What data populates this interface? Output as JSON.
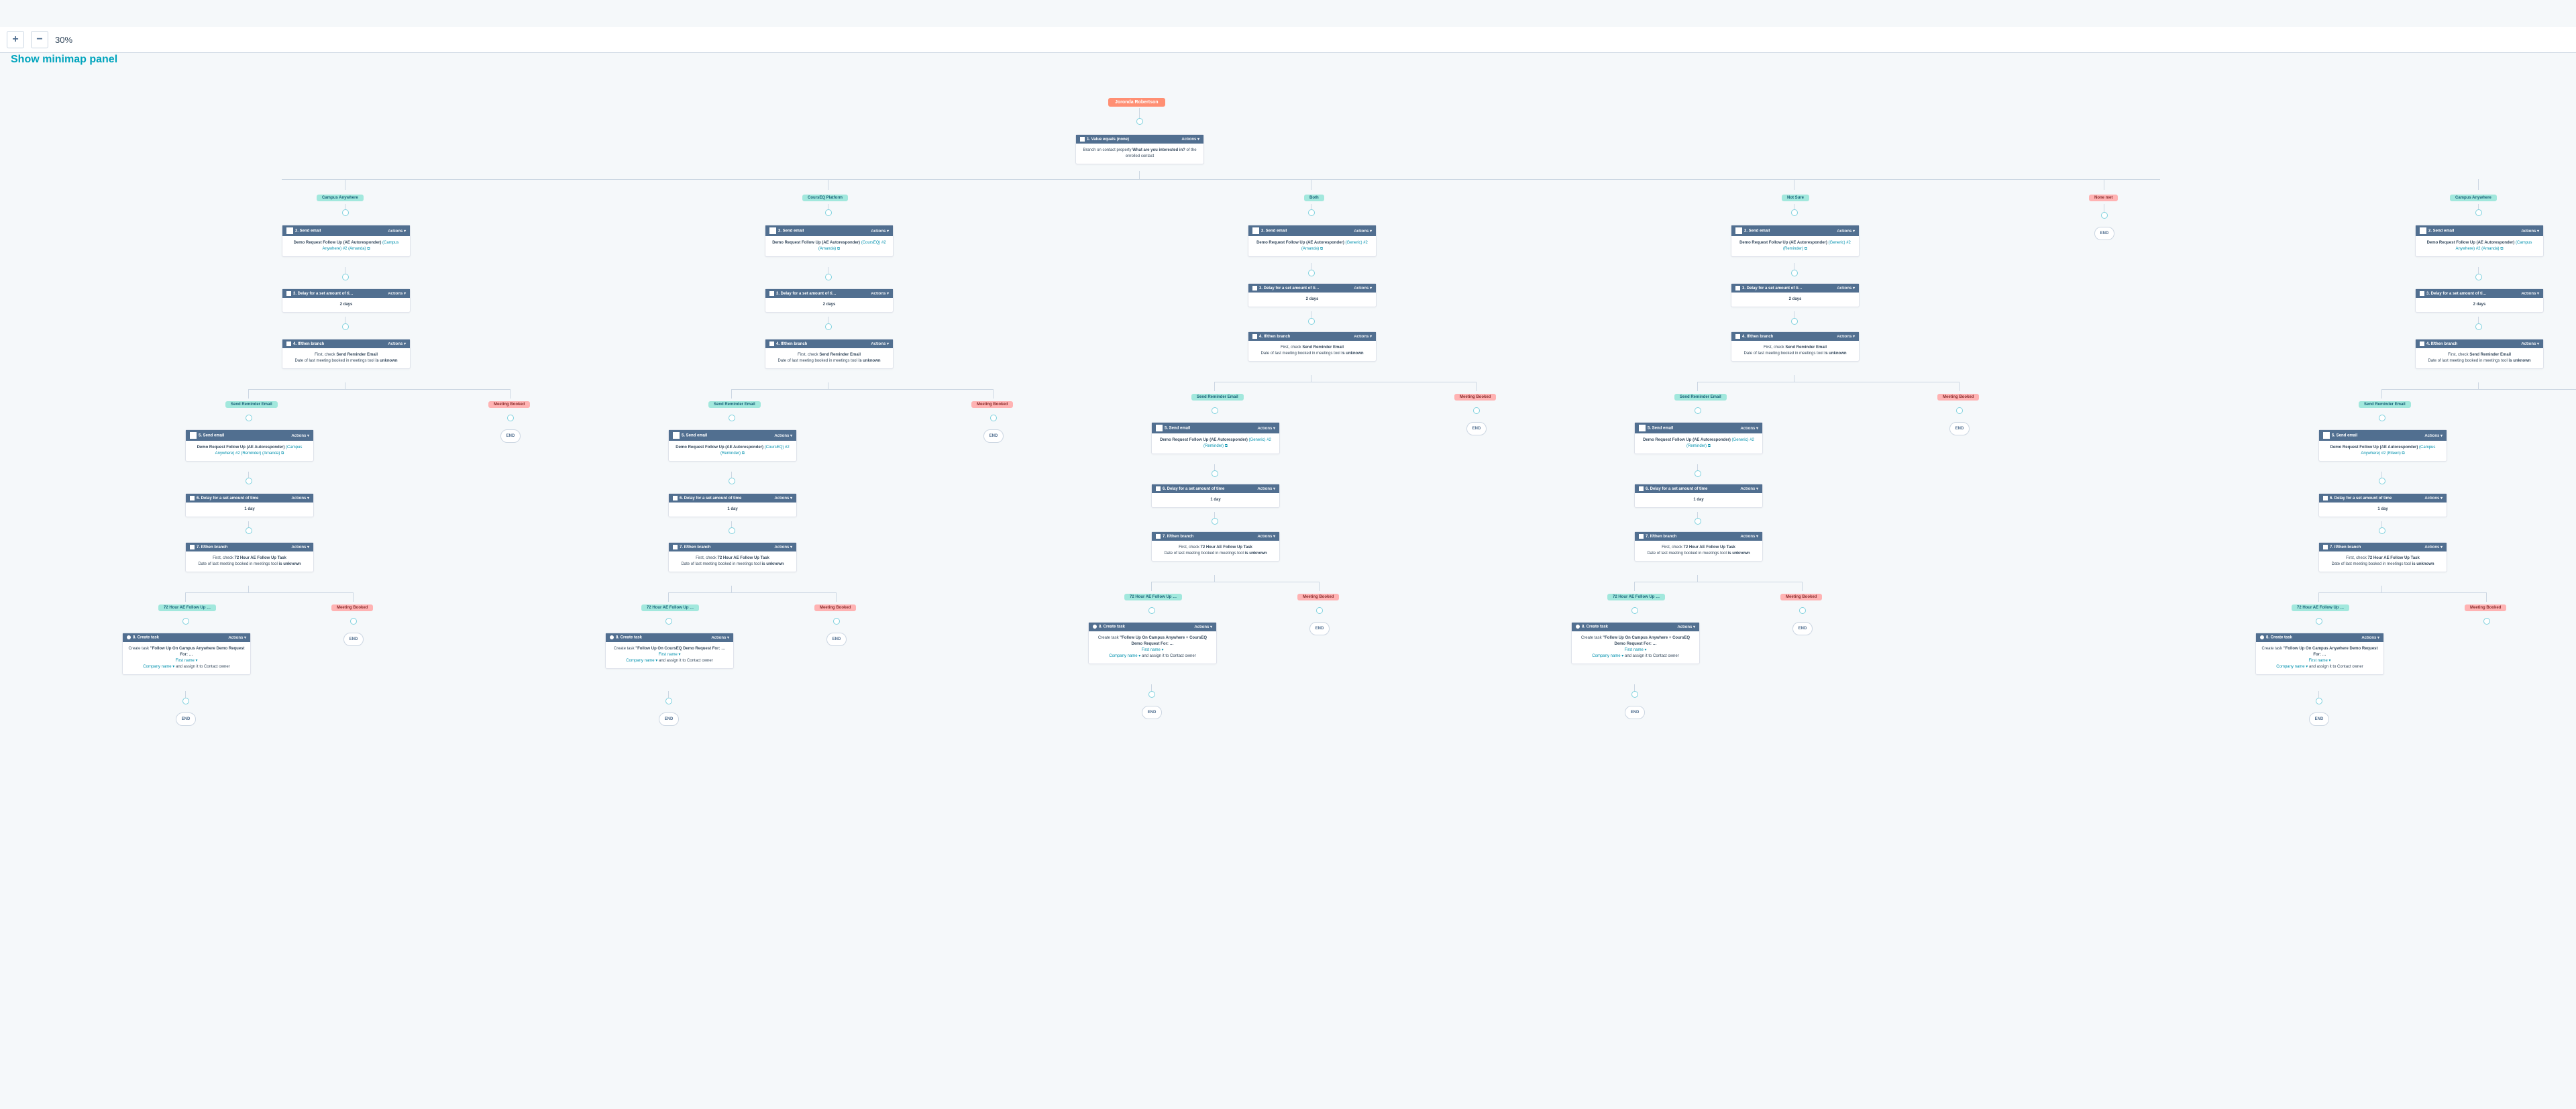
{
  "toolbar": {
    "zoom": "30%",
    "plus": "+",
    "minus": "−"
  },
  "linkbar": "Show minimap panel",
  "trigger": "Joronda Robertson",
  "actions_label": "Actions ▾",
  "root": {
    "header": "1. Value equals (none)",
    "body_pre": "Branch on contact property ",
    "body_bold": "What are you interested in?",
    "body_post": " of the enrolled contact"
  },
  "branch_mid": {
    "send_reminder": "Send Reminder Email",
    "meeting_booked": "Meeting Booked",
    "fu_72": "72 Hour AE Follow Up …",
    "fu_meeting": "Meeting Booked"
  },
  "end_label": "END",
  "branches": {
    "labels": [
      "Campus Anywhere",
      "CoursEQ Platform",
      "Both",
      "Not Sure",
      "None met",
      "Campus Anywhere"
    ]
  },
  "c2": {
    "header": "2. Send email",
    "body_pre": "Demo Request Follow Up (AE Autoresponder)",
    "variants": [
      "(Campus Anywhere) #2 (Amanda) ⧉",
      "(CoursEQ) #2 (Amanda) ⧉",
      "(Generic) #2 (Amanda) ⧉",
      "(Generic) #2 (Reminder) ⧉",
      "(Campus Anywhere) #2 (Amanda) ⧉"
    ]
  },
  "c3": {
    "header_pre": "3. Delay for a set amount of ti…",
    "body": "2 days"
  },
  "c4": {
    "header": "4. If/then branch",
    "body_pre": "First, check ",
    "body_bold": "Send Reminder Email",
    "line2_pre": "Date of last meeting booked in meetings tool ",
    "line2_bold": "is unknown"
  },
  "c5": {
    "header": "5. Send email",
    "body_pre": "Demo Request Follow Up (AE Autoresponder)",
    "variants": [
      "(Campus Anywhere) #2 (Reminder) (Amanda) ⧉",
      "(CoursEQ) #2 (Reminder) ⧉",
      "(Generic) #2 (Reminder) ⧉",
      "(Generic) #2 (Reminder) ⧉",
      "(Campus Anywhere) #2 (Eileen) ⧉"
    ]
  },
  "c6": {
    "header": "6. Delay for a set amount of time",
    "body": "1 day"
  },
  "c7": {
    "header": "7. If/then branch",
    "body_pre": "First, check ",
    "body_bold": "72 Hour AE Follow Up Task",
    "line2_pre": "Date of last meeting booked in meetings tool ",
    "line2_bold": "is unknown"
  },
  "c8": {
    "header": "8. Create task",
    "body_intro": "Create task ",
    "body_titles": [
      "\"Follow Up On Campus Anywhere Demo Request For: …",
      "\"Follow Up On CoursEQ Demo Request For: …",
      "\"Follow Up On Campus Anywhere + CoursEQ Demo Request For: …",
      "\"Follow Up On Campus Anywhere + CoursEQ Demo Request For: …",
      "\"Follow Up On Campus Anywhere Demo Request For: …"
    ],
    "token1": "First name ▾",
    "token2": "Company name ▾",
    "assign": " and assign it to Contact owner"
  }
}
